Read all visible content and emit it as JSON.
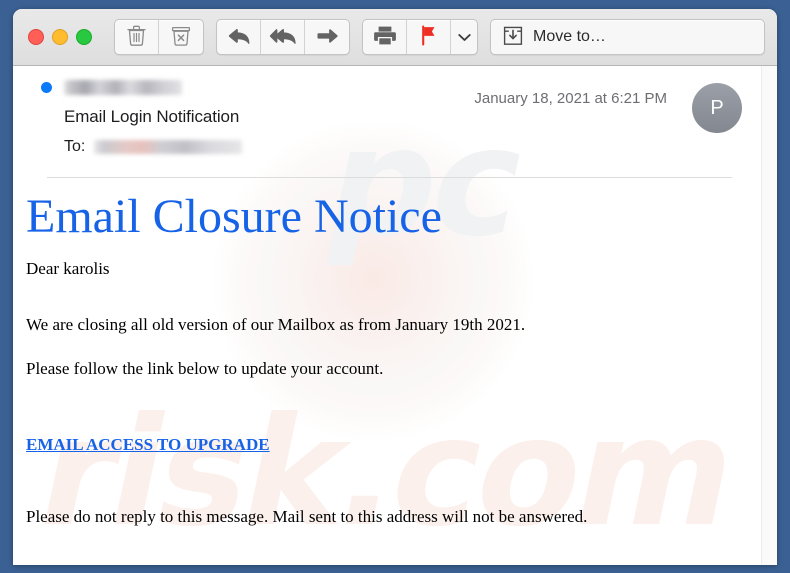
{
  "window": {
    "traffic_lights": [
      {
        "name": "close",
        "color": "#ff5f57"
      },
      {
        "name": "minimize",
        "color": "#febc2e"
      },
      {
        "name": "zoom",
        "color": "#28c840"
      }
    ]
  },
  "toolbar": {
    "delete_label": "Delete",
    "junk_label": "Mark as Junk",
    "reply_label": "Reply",
    "reply_all_label": "Reply All",
    "forward_label": "Forward",
    "print_label": "Print",
    "flag_label": "Flag",
    "flag_color": "#ee2e24",
    "flag_menu_label": "Flag options",
    "move_to_label": "Move to…"
  },
  "message": {
    "unread": true,
    "sender_redacted": true,
    "subject": "Email Login Notification",
    "to_label": "To:",
    "recipient_redacted": true,
    "date": "January 18, 2021 at 6:21 PM",
    "avatar_initial": "P"
  },
  "body": {
    "title": "Email Closure Notice",
    "title_color": "#1763e8",
    "greeting": "Dear karolis",
    "paragraphs": [
      "We are closing all old version of our Mailbox as from January 19th 2021.",
      "Please follow the link below to update your account.",
      "Please do not reply to this message. Mail sent to this address will not be answered."
    ],
    "cta_link": "EMAIL ACCESS TO UPGRADE",
    "cta_color": "#1763e8"
  },
  "watermark": {
    "part1": "pc",
    "part2": "risk.com"
  }
}
